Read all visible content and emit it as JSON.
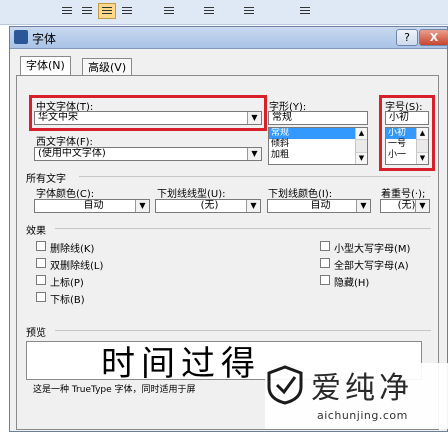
{
  "dialog": {
    "title": "字体",
    "help_label": "?",
    "close_label": "X"
  },
  "tabs": [
    {
      "label": "字体(N)",
      "selected": true
    },
    {
      "label": "高级(V)",
      "selected": false
    }
  ],
  "cn_font": {
    "label": "中文字体(T):",
    "value": "华文中宋"
  },
  "west_font": {
    "label": "西文字体(F):",
    "value": "(使用中文字体)"
  },
  "style": {
    "label": "字形(Y):",
    "value": "常规",
    "options": [
      "常规",
      "倾斜",
      "加粗"
    ],
    "selected_index": 0
  },
  "size": {
    "label": "字号(S):",
    "value": "小初",
    "options": [
      "小初",
      "一号",
      "小一"
    ],
    "selected_index": 0
  },
  "all_text": {
    "section_label": "所有文字",
    "font_color": {
      "label": "字体颜色(C):",
      "value": "自动"
    },
    "underline": {
      "label": "下划线线型(U):",
      "value": "(无)"
    },
    "underline_color": {
      "label": "下划线颜色(I):",
      "value": "自动"
    },
    "emphasis": {
      "label": "着重号(·);",
      "value": "(无)"
    }
  },
  "effects": {
    "section_label": "效果",
    "left": [
      {
        "label": "删除线(K)"
      },
      {
        "label": "双删除线(L)"
      },
      {
        "label": "上标(P)"
      },
      {
        "label": "下标(B)"
      }
    ],
    "right": [
      {
        "label": "小型大写字母(M)"
      },
      {
        "label": "全部大写字母(A)"
      },
      {
        "label": "隐藏(H)"
      }
    ]
  },
  "preview": {
    "label": "预览",
    "sample": "时间过得",
    "note": "这是一种 TrueType 字体，同时适用于屏"
  },
  "watermark": {
    "brand_cn": "爱纯净",
    "url": "aichunjing.com"
  },
  "colors": {
    "highlight": "#d8202a",
    "selection": "#3399ff"
  }
}
